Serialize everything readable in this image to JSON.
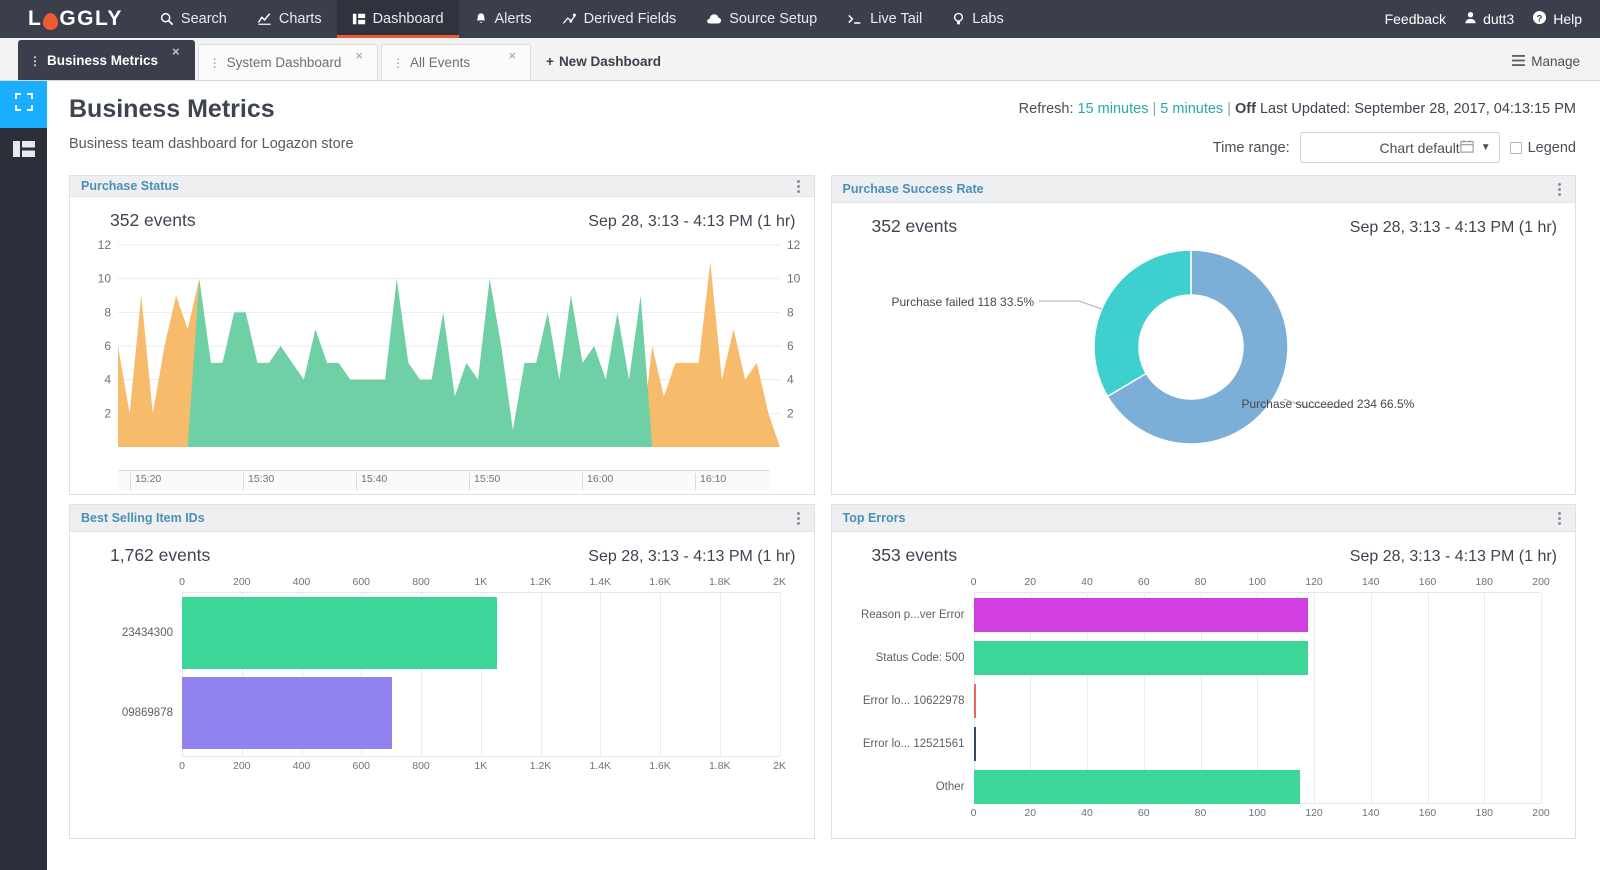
{
  "topnav": {
    "brand": "LOGGLY",
    "items": [
      {
        "label": "Search",
        "icon": "magnifier-icon",
        "active": false
      },
      {
        "label": "Charts",
        "icon": "line-chart-icon",
        "active": false
      },
      {
        "label": "Dashboard",
        "icon": "dashboard-icon",
        "active": true
      },
      {
        "label": "Alerts",
        "icon": "bell-icon",
        "active": false
      },
      {
        "label": "Derived Fields",
        "icon": "derived-fields-icon",
        "active": false
      },
      {
        "label": "Source Setup",
        "icon": "cloud-icon",
        "active": false
      },
      {
        "label": "Live Tail",
        "icon": "terminal-icon",
        "active": false
      },
      {
        "label": "Labs",
        "icon": "lightbulb-icon",
        "active": false
      }
    ],
    "right": {
      "feedback": "Feedback",
      "user": "dutt3",
      "user_icon": "person-icon",
      "help": "Help",
      "help_icon": "question-circle-icon"
    }
  },
  "tabbar": {
    "tabs": [
      {
        "label": "Business Metrics",
        "active": true
      },
      {
        "label": "System Dashboard",
        "active": false
      },
      {
        "label": "All Events",
        "active": false
      }
    ],
    "new_dashboard": "New Dashboard",
    "manage": "Manage"
  },
  "sidebar": {
    "items": [
      {
        "name": "expand-icon",
        "active": true
      },
      {
        "name": "layout-icon",
        "active": false
      }
    ]
  },
  "header": {
    "title": "Business Metrics",
    "subtitle": "Business team dashboard for Logazon store",
    "refresh_label": "Refresh:",
    "refresh_options": [
      "15 minutes",
      "5 minutes"
    ],
    "refresh_off": "Off",
    "last_updated_label": "Last Updated:",
    "last_updated_value": "September 28, 2017, 04:13:15 PM",
    "time_range_label": "Time range:",
    "time_range_value": "Chart default",
    "legend_label": "Legend",
    "legend_checked": false
  },
  "panels": [
    {
      "title": "Purchase Status",
      "events": "352 events",
      "range": "Sep 28, 3:13 - 4:13 PM  (1 hr)"
    },
    {
      "title": "Purchase Success Rate",
      "events": "352 events",
      "range": "Sep 28, 3:13 - 4:13 PM  (1 hr)"
    },
    {
      "title": "Best Selling Item IDs",
      "events": "1,762 events",
      "range": "Sep 28, 3:13 - 4:13 PM  (1 hr)"
    },
    {
      "title": "Top Errors",
      "events": "353 events",
      "range": "Sep 28, 3:13 - 4:13 PM  (1 hr)"
    }
  ],
  "chart_data": [
    {
      "id": "purchase-status",
      "type": "area",
      "title": "Purchase Status",
      "total_events": 352,
      "xlabel": "",
      "ylabel": "",
      "ylim": [
        0,
        12
      ],
      "yticks": [
        2,
        4,
        6,
        8,
        10,
        12
      ],
      "xticks": [
        "15:20",
        "15:30",
        "15:40",
        "15:50",
        "16:00",
        "16:10"
      ],
      "time_range": "Sep 28, 3:13 - 4:13 PM  (1 hr)",
      "grid": true,
      "legend": false,
      "series": [
        {
          "name": "failed",
          "color": "#f7bb6c",
          "values": [
            6,
            2,
            9,
            2,
            6,
            9,
            7,
            10,
            0,
            0,
            0,
            0,
            0,
            0,
            0,
            0,
            0,
            0,
            0,
            0,
            0,
            0,
            0,
            0,
            0,
            0,
            0,
            0,
            0,
            0,
            0,
            0,
            0,
            0,
            0,
            0,
            0,
            0,
            0,
            0,
            0,
            0,
            0,
            0,
            0,
            0,
            6,
            3,
            5,
            5,
            5,
            11,
            4,
            7,
            4,
            5,
            2,
            0
          ]
        },
        {
          "name": "succeeded",
          "color": "#6fcfa5",
          "values": [
            0,
            0,
            0,
            0,
            0,
            0,
            0,
            10,
            5,
            5,
            8,
            8,
            5,
            5,
            6,
            5,
            4,
            7,
            5,
            5,
            4,
            4,
            4,
            4,
            10,
            5,
            4,
            4,
            8,
            3,
            5,
            4,
            10,
            6,
            1,
            5,
            5,
            8,
            4,
            9,
            5,
            6,
            4,
            8,
            4,
            9,
            0,
            0,
            0,
            0,
            0,
            0,
            0,
            0,
            0,
            0,
            0,
            0
          ]
        }
      ]
    },
    {
      "id": "purchase-success-rate",
      "type": "pie",
      "variant": "donut",
      "title": "Purchase Success Rate",
      "total_events": 352,
      "time_range": "Sep 28, 3:13 - 4:13 PM  (1 hr)",
      "slices": [
        {
          "label": "Purchase succeeded",
          "value": 234,
          "percent": 66.5,
          "color": "#7cafd8",
          "annotation": "Purchase succeeded 234 66.5%"
        },
        {
          "label": "Purchase failed",
          "value": 118,
          "percent": 33.5,
          "color": "#3ecfcf",
          "annotation": "Purchase failed 118 33.5%"
        }
      ]
    },
    {
      "id": "best-selling-item-ids",
      "type": "bar",
      "orientation": "horizontal",
      "title": "Best Selling Item IDs",
      "total_events": 1762,
      "time_range": "Sep 28, 3:13 - 4:13 PM  (1 hr)",
      "xlim": [
        0,
        2000
      ],
      "xticks": [
        "0",
        "200",
        "400",
        "600",
        "800",
        "1K",
        "1.2K",
        "1.4K",
        "1.6K",
        "1.8K",
        "2K"
      ],
      "categories": [
        "23434300",
        "09869878"
      ],
      "values": [
        1055,
        702
      ],
      "colors": [
        "#3ed598",
        "#9184f0"
      ]
    },
    {
      "id": "top-errors",
      "type": "bar",
      "orientation": "horizontal",
      "title": "Top Errors",
      "total_events": 353,
      "time_range": "Sep 28, 3:13 - 4:13 PM  (1 hr)",
      "xlim": [
        0,
        200
      ],
      "xticks": [
        "0",
        "20",
        "40",
        "60",
        "80",
        "100",
        "120",
        "140",
        "160",
        "180",
        "200"
      ],
      "categories": [
        "Reason p...ver Error",
        "Status Code: 500",
        "Error lo... 10622978",
        "Error lo... 12521561",
        "Other"
      ],
      "values": [
        118,
        118,
        1,
        1,
        115
      ],
      "colors": [
        "#d councils",
        "#3ed598",
        "#e8695a",
        "#2d4a6b",
        "#3ed598"
      ],
      "bar_colors": [
        "#d councils",
        "#3ed598",
        "#e8695a",
        "#2d4a6b",
        "#3ed598"
      ]
    }
  ],
  "colors": {
    "brand_orange": "#ee5b33",
    "nav_bg": "#3b3f4c",
    "panel_title": "#4a90b9",
    "accent_blue": "#19aeff",
    "link_teal": "#2aa8a8"
  }
}
